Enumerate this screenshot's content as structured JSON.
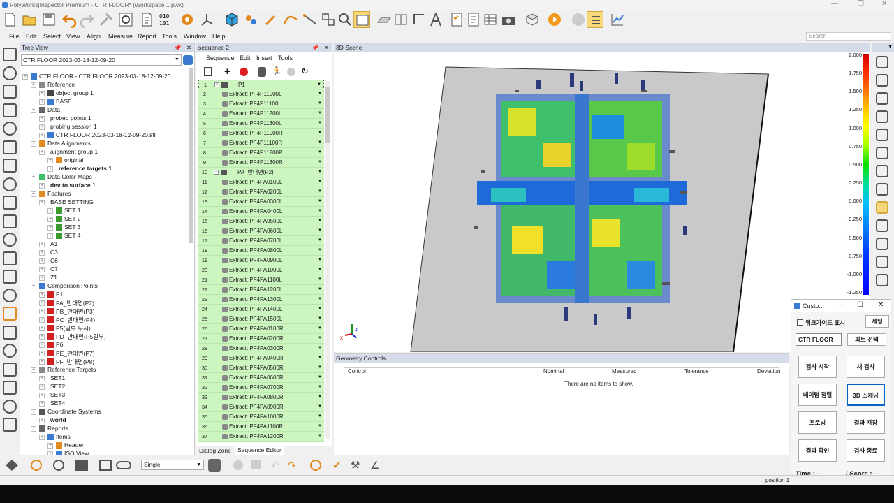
{
  "window": {
    "title": "PolyWorks|Inspector Premium - CTR FLOOR* (Workspace 1.pwk)"
  },
  "menu": [
    "File",
    "Edit",
    "Select",
    "View",
    "Align",
    "Measure",
    "Report",
    "Tools",
    "Window",
    "Help"
  ],
  "search": {
    "placeholder": "Search"
  },
  "tree": {
    "header": "Tree View",
    "combo": "CTR FLOOR 2023-03-18-12-09-20",
    "rows": [
      {
        "t": "CTR FLOOR - CTR FLOOR 2023-03-18-12-09-20",
        "l": 0,
        "i": "doc"
      },
      {
        "t": "Reference",
        "l": 1,
        "i": "ref"
      },
      {
        "t": "object group 1",
        "l": 2,
        "i": "grp"
      },
      {
        "t": "BASE",
        "l": 2,
        "i": "obj"
      },
      {
        "t": "Data",
        "l": 1,
        "i": "data"
      },
      {
        "t": "probed points 1",
        "l": 2,
        "i": "none"
      },
      {
        "t": "probing session 1",
        "l": 2,
        "i": "none"
      },
      {
        "t": "CTR FLOOR 2023-03-18-12-09-20.stl",
        "l": 2,
        "i": "obj"
      },
      {
        "t": "Data Alignments",
        "l": 1,
        "i": "align"
      },
      {
        "t": "alignment group 1",
        "l": 2,
        "i": "none"
      },
      {
        "t": "original",
        "l": 3,
        "i": "align"
      },
      {
        "t": "reference targets 1",
        "l": 3,
        "i": "none",
        "b": true
      },
      {
        "t": "Data Color Maps",
        "l": 1,
        "i": "cmap"
      },
      {
        "t": "dev to surface 1",
        "l": 2,
        "i": "none",
        "b": true
      },
      {
        "t": "Features",
        "l": 1,
        "i": "feat"
      },
      {
        "t": "BASE SETTING",
        "l": 2,
        "i": "none"
      },
      {
        "t": "SET 1",
        "l": 3,
        "i": "set"
      },
      {
        "t": "SET 2",
        "l": 3,
        "i": "set"
      },
      {
        "t": "SET 3",
        "l": 3,
        "i": "set"
      },
      {
        "t": "SET 4",
        "l": 3,
        "i": "set"
      },
      {
        "t": "A1",
        "l": 2,
        "i": "none"
      },
      {
        "t": "C3",
        "l": 2,
        "i": "none"
      },
      {
        "t": "C6",
        "l": 2,
        "i": "none"
      },
      {
        "t": "C7",
        "l": 2,
        "i": "none"
      },
      {
        "t": "Z1",
        "l": 2,
        "i": "none"
      },
      {
        "t": "Comparison Points",
        "l": 1,
        "i": "cp"
      },
      {
        "t": "P1",
        "l": 2,
        "i": "pt"
      },
      {
        "t": "PA_반대면(P2)",
        "l": 2,
        "i": "pt"
      },
      {
        "t": "PB_반대면(P3)",
        "l": 2,
        "i": "pt"
      },
      {
        "t": "PC_반대면(P4)",
        "l": 2,
        "i": "pt"
      },
      {
        "t": "P5(일부 무시)",
        "l": 2,
        "i": "pt"
      },
      {
        "t": "PD_반대면(P5일부)",
        "l": 2,
        "i": "pt"
      },
      {
        "t": "P6",
        "l": 2,
        "i": "pt"
      },
      {
        "t": "PE_반대면(P7)",
        "l": 2,
        "i": "pt"
      },
      {
        "t": "PF_반대면(P8)",
        "l": 2,
        "i": "pt"
      },
      {
        "t": "Reference Targets",
        "l": 1,
        "i": "rt"
      },
      {
        "t": "SET1",
        "l": 2,
        "i": "none"
      },
      {
        "t": "SET2",
        "l": 2,
        "i": "none"
      },
      {
        "t": "SET3",
        "l": 2,
        "i": "none"
      },
      {
        "t": "SET4",
        "l": 2,
        "i": "none"
      },
      {
        "t": "Coordinate Systems",
        "l": 1,
        "i": "cs"
      },
      {
        "t": "world",
        "l": 2,
        "i": "none",
        "b": true
      },
      {
        "t": "Reports",
        "l": 1,
        "i": "rep"
      },
      {
        "t": "Items",
        "l": 2,
        "i": "items"
      },
      {
        "t": "Header",
        "l": 3,
        "i": "hdr"
      },
      {
        "t": "ISO View",
        "l": 3,
        "i": "iso"
      }
    ]
  },
  "seq": {
    "header": "sequence 2",
    "menu": [
      "Sequence",
      "Edit",
      "Insert",
      "Tools"
    ],
    "rows": [
      {
        "n": "1",
        "t": "P1",
        "g": true
      },
      {
        "n": "2",
        "t": "Extract: PF4P11000L"
      },
      {
        "n": "3",
        "t": "Extract: PF4P11100L"
      },
      {
        "n": "4",
        "t": "Extract: PF4P11200L"
      },
      {
        "n": "5",
        "t": "Extract: PF4P11300L"
      },
      {
        "n": "6",
        "t": "Extract: PF4P11000R"
      },
      {
        "n": "7",
        "t": "Extract: PF4P11100R"
      },
      {
        "n": "8",
        "t": "Extract: PF4P11200R"
      },
      {
        "n": "9",
        "t": "Extract: PF4P11300R"
      },
      {
        "n": "10",
        "t": "PA_반대면(P2)",
        "g": true
      },
      {
        "n": "11",
        "t": "Extract: PF4PA0100L"
      },
      {
        "n": "12",
        "t": "Extract: PF4PA0200L"
      },
      {
        "n": "13",
        "t": "Extract: PF4PA0300L"
      },
      {
        "n": "14",
        "t": "Extract: PF4PA0400L"
      },
      {
        "n": "15",
        "t": "Extract: PF4PA0500L"
      },
      {
        "n": "16",
        "t": "Extract: PF4PA0600L"
      },
      {
        "n": "17",
        "t": "Extract: PF4PA0700L"
      },
      {
        "n": "18",
        "t": "Extract: PF4PA0800L"
      },
      {
        "n": "19",
        "t": "Extract: PF4PA0900L"
      },
      {
        "n": "20",
        "t": "Extract: PF4PA1000L"
      },
      {
        "n": "21",
        "t": "Extract: PF4PA1100L"
      },
      {
        "n": "22",
        "t": "Extract: PF4PA1200L"
      },
      {
        "n": "23",
        "t": "Extract: PF4PA1300L"
      },
      {
        "n": "24",
        "t": "Extract: PF4PA1400L"
      },
      {
        "n": "25",
        "t": "Extract: PF4PA1500L"
      },
      {
        "n": "26",
        "t": "Extract: PF4PA0100R"
      },
      {
        "n": "27",
        "t": "Extract: PF4PA0200R"
      },
      {
        "n": "28",
        "t": "Extract: PF4PA0300R"
      },
      {
        "n": "29",
        "t": "Extract: PF4PA0400R"
      },
      {
        "n": "30",
        "t": "Extract: PF4PA0500R"
      },
      {
        "n": "31",
        "t": "Extract: PF4PA0600R"
      },
      {
        "n": "32",
        "t": "Extract: PF4PA0700R"
      },
      {
        "n": "33",
        "t": "Extract: PF4PA0800R"
      },
      {
        "n": "34",
        "t": "Extract: PF4PA0900R"
      },
      {
        "n": "35",
        "t": "Extract: PF4PA1000R"
      },
      {
        "n": "36",
        "t": "Extract: PF4PA1100R"
      },
      {
        "n": "37",
        "t": "Extract: PF4PA1200R"
      }
    ],
    "tabs": [
      "Dialog Zone",
      "Sequence Editor"
    ]
  },
  "scene": {
    "header": "3D Scene",
    "scale": [
      "2.000",
      "1.750",
      "1.500",
      "1.250",
      "1.000",
      "0.750",
      "0.500",
      "0.250",
      "0.000",
      "-0.250",
      "-0.500",
      "-0.750",
      "-1.000",
      "-1.250"
    ]
  },
  "gc": {
    "header": "Geometry Controls",
    "cols": [
      "Control",
      "Nominal",
      "Measured",
      "Tolerance",
      "Deviation"
    ],
    "empty": "There are no items to show."
  },
  "custom": {
    "title": "Custo...",
    "checkbox": "워크가이드 표시",
    "setting": "세팅",
    "part_value": "CTR FLOOR",
    "part_select": "파트 선택",
    "buttons": [
      "검사 시작",
      "새 검사",
      "데이텀 정렬",
      "3D 스캐닝",
      "프로빙",
      "결과 저장",
      "결과 확인",
      "검사 종료"
    ],
    "time": "Time : -",
    "score": "/ Score : -"
  },
  "bottom": {
    "mode": "Single"
  },
  "status": {
    "text": "position 1"
  },
  "colors": {
    "accent": "#0a64c8",
    "seq_green": "#ccf5c0",
    "panel_header": "#d6dbe9"
  }
}
